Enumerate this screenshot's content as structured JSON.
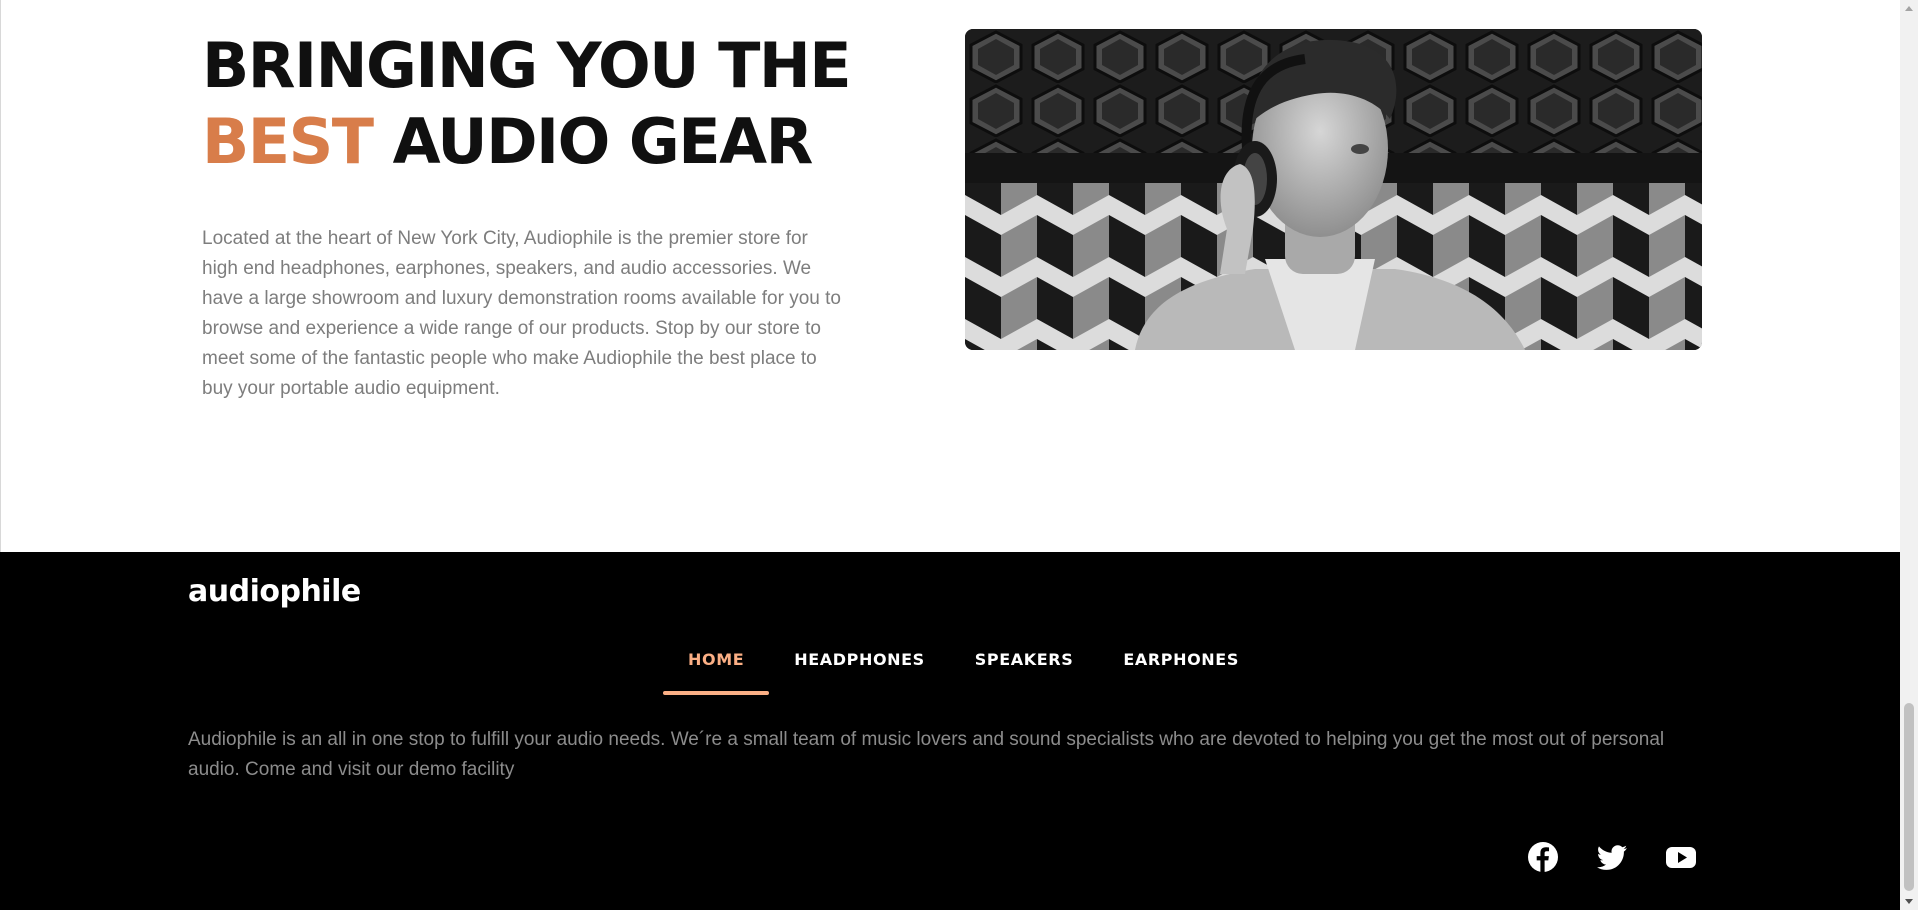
{
  "about": {
    "headline_line1": "BRINGING YOU THE",
    "headline_accent": "BEST",
    "headline_rest": "AUDIO GEAR",
    "description": "Located at the heart of New York City, Audiophile is the premier store for high end headphones, earphones, speakers, and audio accessories. We have a large showroom and luxury demonstration rooms available for you to browse and experience a wide range of our products. Stop by our store to meet some of the fantastic people who make Audiophile the best place to buy your portable audio equipment."
  },
  "footer": {
    "logo": "audiophile",
    "nav": [
      {
        "label": "HOME",
        "active": true
      },
      {
        "label": "HEADPHONES",
        "active": false
      },
      {
        "label": "SPEAKERS",
        "active": false
      },
      {
        "label": "EARPHONES",
        "active": false
      }
    ],
    "description": "Audiophile is an all in one stop to fulfill your audio needs. We´re a small team of music lovers and sound specialists who are devoted to helping you get the most out of personal audio. Come and visit our demo facility",
    "social": [
      "facebook-icon",
      "twitter-icon",
      "youtube-icon"
    ]
  },
  "colors": {
    "accent": "#d87d4a",
    "nav_active": "#fbaf85",
    "footer_bg": "#000000",
    "body_text": "#7d7d7d"
  }
}
